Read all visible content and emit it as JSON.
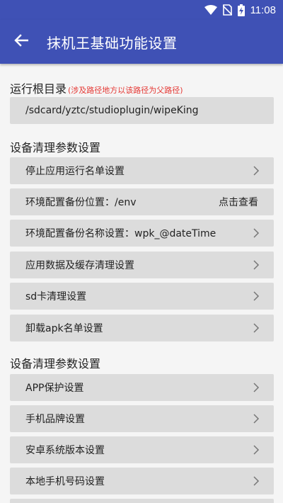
{
  "status_bar": {
    "time": "11:08",
    "icons": [
      "wifi-icon",
      "no-sim-icon",
      "battery-charging-icon"
    ]
  },
  "app_bar": {
    "back_icon": "arrow-left-icon",
    "title": "抹机王基础功能设置"
  },
  "root_dir": {
    "title": "运行根目录",
    "note": "(涉及路径地方以该路径为父路径)",
    "path": "/sdcard/yztc/studioplugin/wipeKing"
  },
  "section1": {
    "title": "设备清理参数设置",
    "items": [
      {
        "label": "停止应用运行名单设置",
        "action": "",
        "chevron": true
      },
      {
        "label": "环境配置备份位置：/env",
        "action": "点击查看",
        "chevron": false
      },
      {
        "label": "环境配置备份名称设置：wpk_@dateTime",
        "action": "",
        "chevron": true
      },
      {
        "label": "应用数据及缓存清理设置",
        "action": "",
        "chevron": true
      },
      {
        "label": "sd卡清理设置",
        "action": "",
        "chevron": true
      },
      {
        "label": "卸载apk名单设置",
        "action": "",
        "chevron": true
      }
    ]
  },
  "section2": {
    "title": "设备清理参数设置",
    "items": [
      {
        "label": "APP保护设置",
        "chevron": true
      },
      {
        "label": "手机品牌设置",
        "chevron": true
      },
      {
        "label": "安卓系统版本设置",
        "chevron": true
      },
      {
        "label": "本地手机号码设置",
        "chevron": true
      }
    ]
  },
  "colors": {
    "primary": "#3f51b5",
    "row_bg": "#dcdcdc",
    "note": "#e53935"
  }
}
